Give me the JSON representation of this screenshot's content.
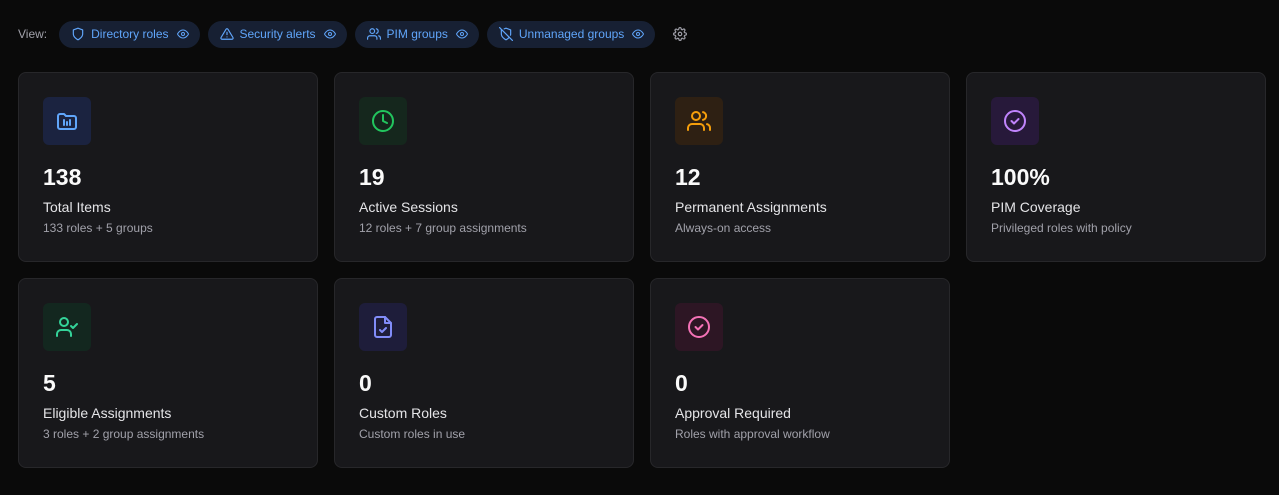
{
  "view_bar": {
    "label": "View:",
    "chips": [
      {
        "label": "Directory roles",
        "icon": "shield-icon"
      },
      {
        "label": "Security alerts",
        "icon": "alert-triangle-icon"
      },
      {
        "label": "PIM groups",
        "icon": "users-icon"
      },
      {
        "label": "Unmanaged groups",
        "icon": "shield-off-icon"
      }
    ],
    "settings_icon": "gear-icon"
  },
  "cards": [
    {
      "value": "138",
      "title": "Total Items",
      "subtitle": "133 roles + 5 groups",
      "icon": "folder-chart-icon",
      "color": "#60a5fa",
      "bg": "#1b2340"
    },
    {
      "value": "19",
      "title": "Active Sessions",
      "subtitle": "12 roles + 7 group assignments",
      "icon": "clock-icon",
      "color": "#22c55e",
      "bg": "#15271d"
    },
    {
      "value": "12",
      "title": "Permanent Assignments",
      "subtitle": "Always-on access",
      "icon": "users-icon",
      "color": "#f59e0b",
      "bg": "#2e2013"
    },
    {
      "value": "100%",
      "title": "PIM Coverage",
      "subtitle": "Privileged roles with policy",
      "icon": "check-circle-icon",
      "color": "#c084fc",
      "bg": "#27193a"
    },
    {
      "value": "5",
      "title": "Eligible Assignments",
      "subtitle": "3 roles + 2 group assignments",
      "icon": "user-check-icon",
      "color": "#34d399",
      "bg": "#13271f"
    },
    {
      "value": "0",
      "title": "Custom Roles",
      "subtitle": "Custom roles in use",
      "icon": "file-check-icon",
      "color": "#818cf8",
      "bg": "#1e1d3a"
    },
    {
      "value": "0",
      "title": "Approval Required",
      "subtitle": "Roles with approval workflow",
      "icon": "check-circle-icon",
      "color": "#f472b6",
      "bg": "#2d1624"
    }
  ]
}
